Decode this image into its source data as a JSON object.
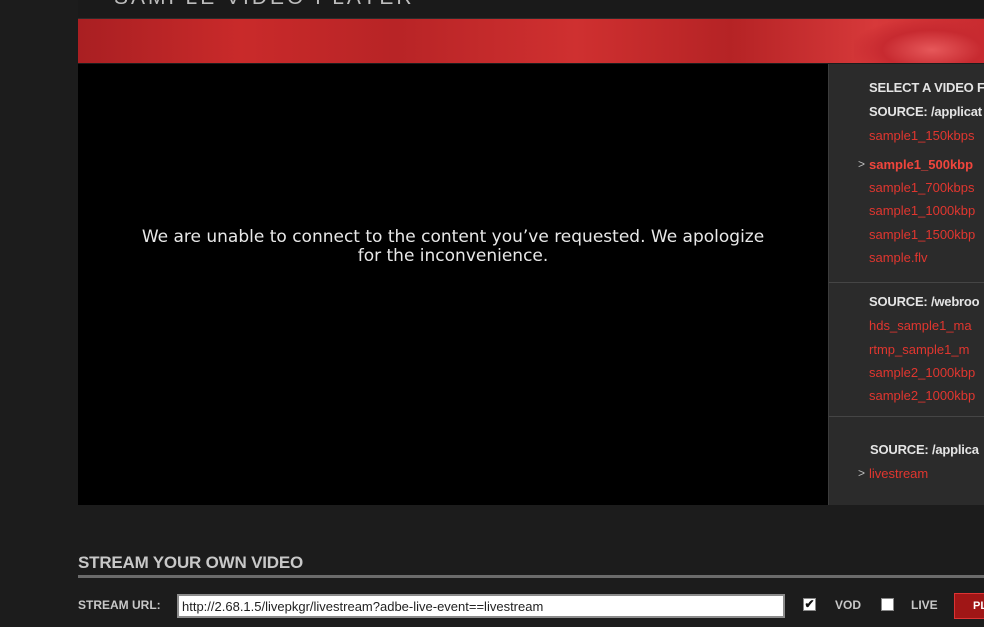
{
  "page": {
    "title": "SAMPLE VIDEO PLAYER"
  },
  "video": {
    "error_message": "We are unable to connect to the content you’ve requested. We apologize for the inconvenience."
  },
  "playlist": {
    "heading": "SELECT A VIDEO F",
    "sections": [
      {
        "source_label": "SOURCE: /applicat",
        "items": [
          {
            "label": "sample1_150kbps",
            "selected": false
          },
          {
            "label": "sample1_500kbp",
            "selected": true
          },
          {
            "label": "sample1_700kbps",
            "selected": false
          },
          {
            "label": "sample1_1000kbp",
            "selected": false
          },
          {
            "label": "sample1_1500kbp",
            "selected": false
          },
          {
            "label": "sample.flv",
            "selected": false
          }
        ]
      },
      {
        "source_label": "SOURCE: /webroo",
        "items": [
          {
            "label": "hds_sample1_ma",
            "selected": false
          },
          {
            "label": "rtmp_sample1_m",
            "selected": false
          },
          {
            "label": "sample2_1000kbp",
            "selected": false
          },
          {
            "label": "sample2_1000kbp",
            "selected": false
          }
        ]
      },
      {
        "source_label": "SOURCE: /applica",
        "items": [
          {
            "label": "livestream",
            "selected": true
          }
        ]
      }
    ],
    "selected_marker": ">"
  },
  "stream": {
    "heading": "STREAM YOUR OWN VIDEO",
    "url_label": "STREAM URL:",
    "url_value": "http://2.68.1.5/livepkgr/livestream?adbe-live-event==livestream",
    "vod_label": "VOD",
    "vod_checked": true,
    "live_label": "LIVE",
    "live_checked": false,
    "play_label": "PLAY"
  },
  "colors": {
    "accent": "#e0362f",
    "banner": "#c92a2a",
    "background": "#1c1c1c"
  }
}
